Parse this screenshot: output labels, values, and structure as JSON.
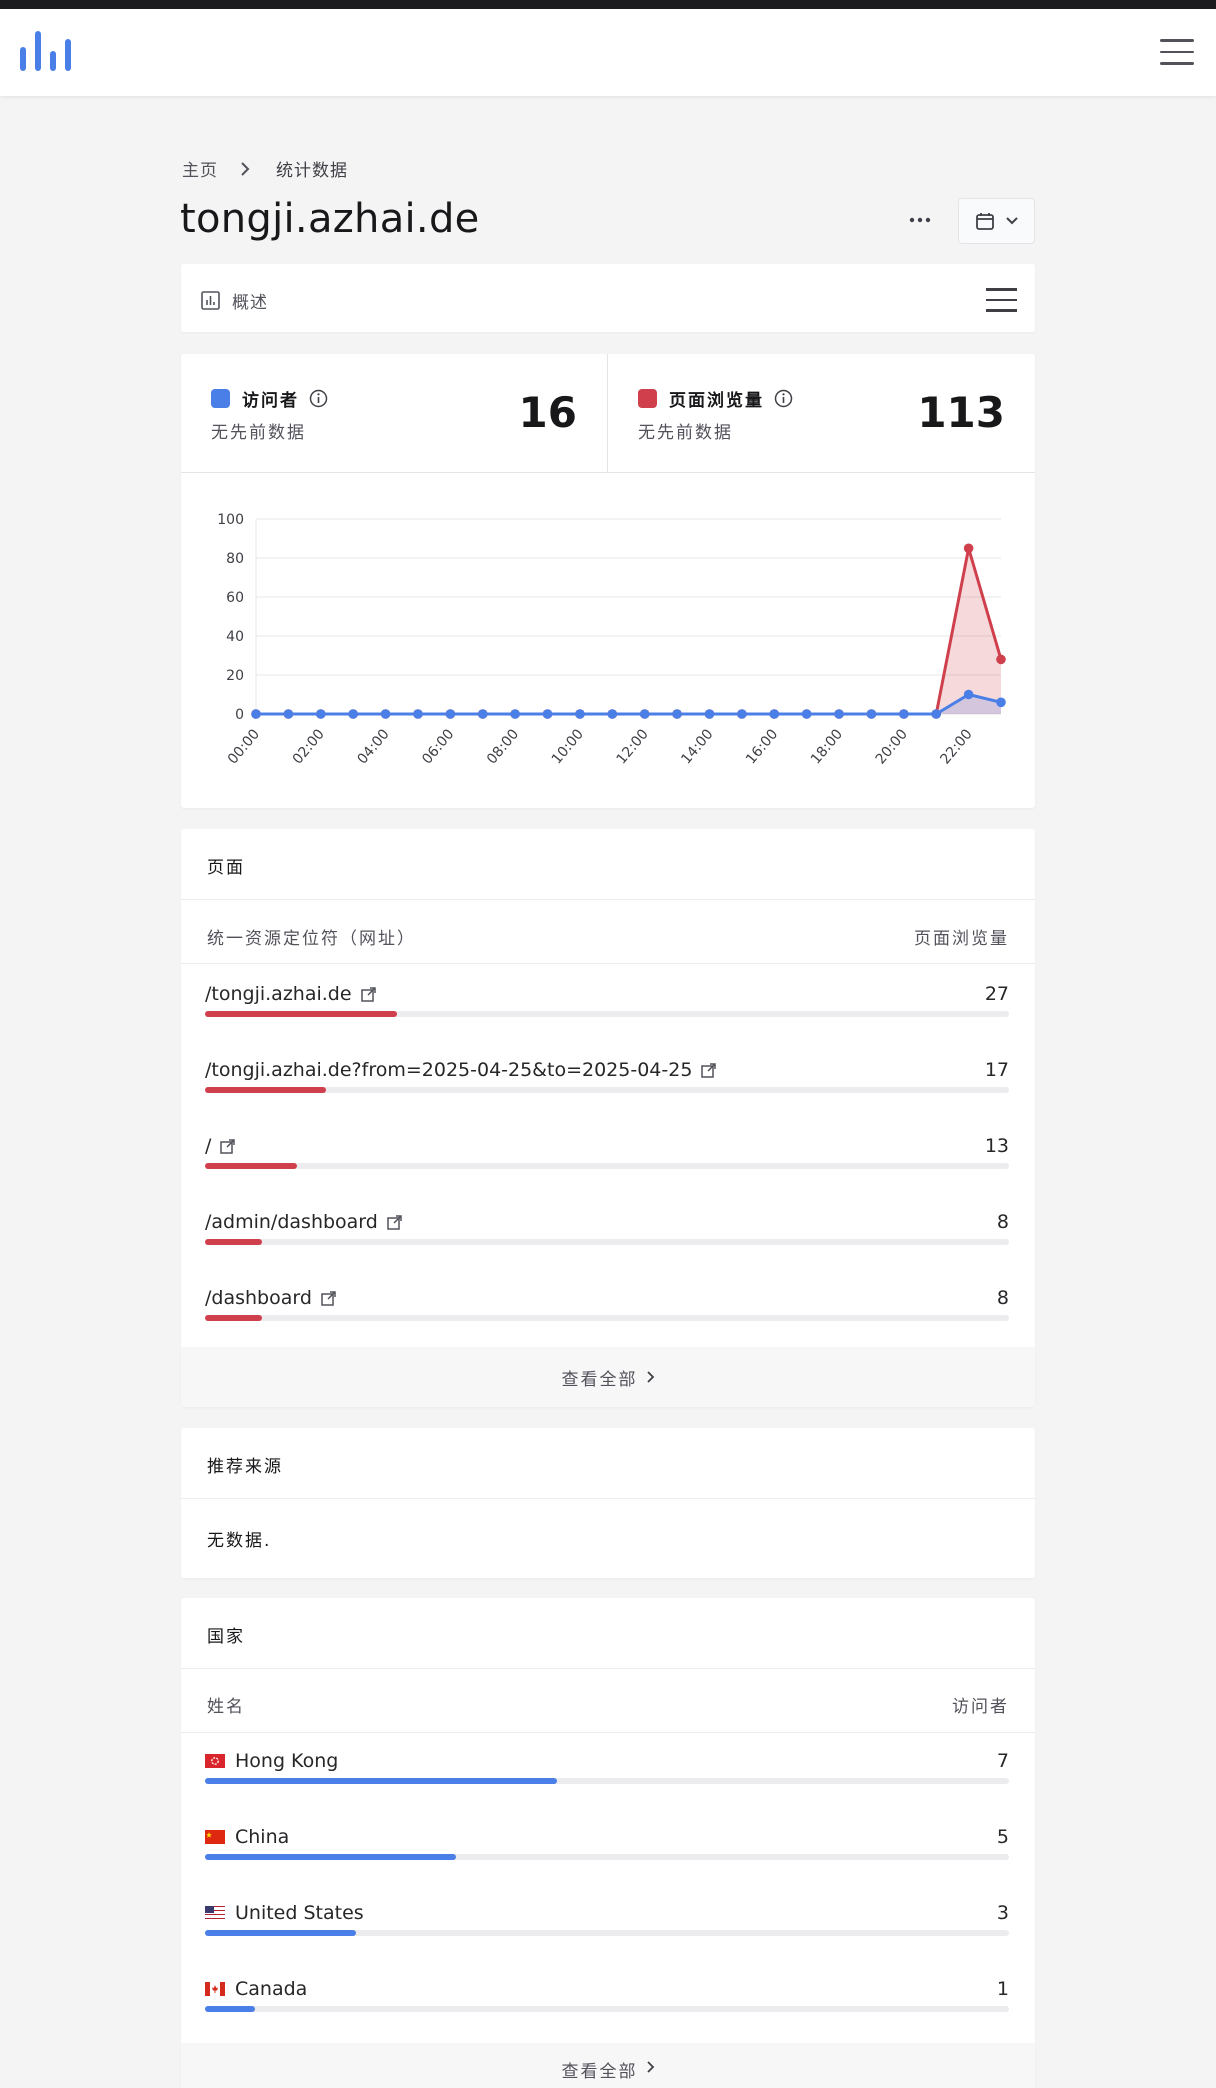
{
  "breadcrumb": {
    "home": "主页",
    "current": "统计数据"
  },
  "title": "tongji.azhai.de",
  "tabs": {
    "overview": "概述"
  },
  "stats": {
    "visitors": {
      "label": "访问者",
      "sub": "无先前数据",
      "value": "16",
      "color": "#4a7fe8"
    },
    "pageviews": {
      "label": "页面浏览量",
      "sub": "无先前数据",
      "value": "113",
      "color": "#cf3f4c"
    }
  },
  "chart_data": {
    "type": "line",
    "x": [
      "00:00",
      "01:00",
      "02:00",
      "03:00",
      "04:00",
      "05:00",
      "06:00",
      "07:00",
      "08:00",
      "09:00",
      "10:00",
      "11:00",
      "12:00",
      "13:00",
      "14:00",
      "15:00",
      "16:00",
      "17:00",
      "18:00",
      "19:00",
      "20:00",
      "21:00",
      "22:00",
      "23:00"
    ],
    "tick_labels": [
      "00:00",
      "02:00",
      "04:00",
      "06:00",
      "08:00",
      "10:00",
      "12:00",
      "14:00",
      "16:00",
      "18:00",
      "20:00",
      "22:00"
    ],
    "series": [
      {
        "values": [
          0,
          0,
          0,
          0,
          0,
          0,
          0,
          0,
          0,
          0,
          0,
          0,
          0,
          0,
          0,
          0,
          0,
          0,
          0,
          0,
          0,
          0,
          85,
          28
        ],
        "color": "#cf3f4c"
      },
      {
        "values": [
          0,
          0,
          0,
          0,
          0,
          0,
          0,
          0,
          0,
          0,
          0,
          0,
          0,
          0,
          0,
          0,
          0,
          0,
          0,
          0,
          0,
          0,
          10,
          6
        ],
        "color": "#4a7fe8"
      }
    ],
    "yticks": [
      "0",
      "20",
      "40",
      "60",
      "80",
      "100"
    ],
    "ylim": [
      0,
      100
    ],
    "grid": true
  },
  "pages": {
    "title": "页面",
    "col_left": "统一资源定位符（网址）",
    "col_right": "页面浏览量",
    "max": 113,
    "rows": [
      {
        "label": "/tongji.azhai.de",
        "value": "27",
        "count": 27
      },
      {
        "label": "/tongji.azhai.de?from=2025-04-25&to=2025-04-25",
        "value": "17",
        "count": 17
      },
      {
        "label": "/",
        "value": "13",
        "count": 13
      },
      {
        "label": "/admin/dashboard",
        "value": "8",
        "count": 8
      },
      {
        "label": "/dashboard",
        "value": "8",
        "count": 8
      }
    ],
    "view_all": "查看全部"
  },
  "referrers": {
    "title": "推荐来源",
    "empty": "无数据."
  },
  "countries": {
    "title": "国家",
    "col_left": "姓名",
    "col_right": "访问者",
    "max": 16,
    "rows": [
      {
        "label": "Hong Kong",
        "value": "7",
        "count": 7,
        "flag": "hk"
      },
      {
        "label": "China",
        "value": "5",
        "count": 5,
        "flag": "cn"
      },
      {
        "label": "United States",
        "value": "3",
        "count": 3,
        "flag": "us"
      },
      {
        "label": "Canada",
        "value": "1",
        "count": 1,
        "flag": "ca"
      }
    ],
    "view_all": "查看全部"
  }
}
